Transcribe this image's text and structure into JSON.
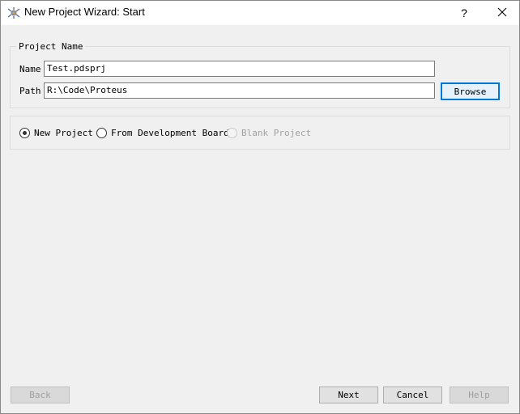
{
  "window": {
    "title": "New Project Wizard: Start",
    "help_label": "?"
  },
  "project_name": {
    "legend": "Project Name",
    "name_label": "Name",
    "name_value": "Test.pdsprj",
    "path_label": "Path",
    "path_value": "R:\\Code\\Proteus",
    "browse_label": "Browse"
  },
  "project_type": {
    "options": [
      {
        "label": "New Project",
        "selected": true,
        "enabled": true
      },
      {
        "label": "From Development Board",
        "selected": false,
        "enabled": true
      },
      {
        "label": "Blank Project",
        "selected": false,
        "enabled": false
      }
    ]
  },
  "footer": {
    "back_label": "Back",
    "next_label": "Next",
    "cancel_label": "Cancel",
    "help_label": "Help"
  },
  "colors": {
    "accent": "#0078d7",
    "background": "#f0f0f0"
  },
  "icons": {
    "app": "proteus-app-icon",
    "close": "close-icon"
  }
}
